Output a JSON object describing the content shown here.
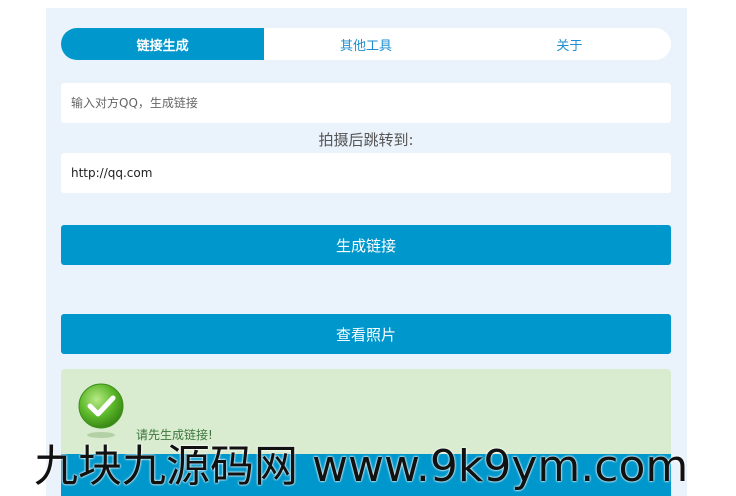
{
  "tabs": [
    {
      "label": "链接生成"
    },
    {
      "label": "其他工具"
    },
    {
      "label": "关于"
    }
  ],
  "form": {
    "qq_placeholder": "输入对方QQ，生成链接",
    "redirect_label": "拍摄后跳转到:",
    "redirect_value": "http://qq.com"
  },
  "buttons": {
    "generate": "生成链接",
    "view": "查看照片"
  },
  "alert": {
    "message": "请先生成链接!"
  },
  "watermark": "九块九源码网 www.9k9ym.com",
  "colors": {
    "accent": "#0098cc",
    "panel": "#eaf2fc",
    "success_bg": "#d9ecd0"
  },
  "icons": {
    "success": "check-circle-icon"
  }
}
